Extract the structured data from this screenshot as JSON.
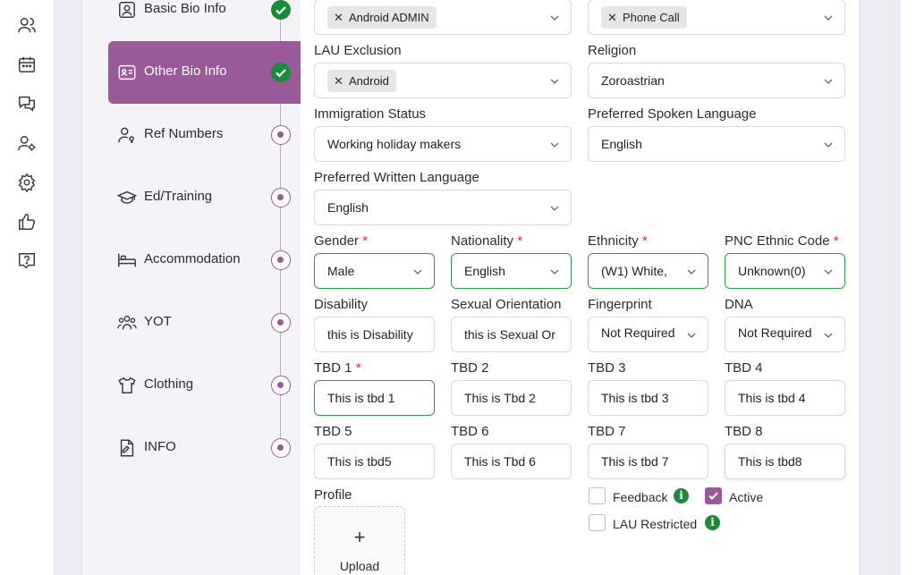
{
  "rail": {
    "icons": [
      "users-icon",
      "calendar-icon",
      "chat-icon",
      "user-settings-icon",
      "gear-icon",
      "thumbs-up-icon",
      "help-chat-icon"
    ]
  },
  "steps": [
    {
      "label": "Basic Bio Info",
      "icon": "user-badge-icon",
      "status": "done"
    },
    {
      "label": "Other Bio Info",
      "icon": "id-card-icon",
      "status": "done",
      "active": true
    },
    {
      "label": "Ref Numbers",
      "icon": "user-key-icon",
      "status": "pending"
    },
    {
      "label": "Ed/Training",
      "icon": "graduation-cap-icon",
      "status": "pending"
    },
    {
      "label": "Accommodation",
      "icon": "bed-icon",
      "status": "pending"
    },
    {
      "label": "YOT",
      "icon": "group-icon",
      "status": "pending"
    },
    {
      "label": "Clothing",
      "icon": "shirt-icon",
      "status": "pending"
    },
    {
      "label": "INFO",
      "icon": "document-icon",
      "status": "pending"
    }
  ],
  "form": {
    "top_left_tag": "Android ADMIN",
    "top_right_tag": "Phone Call",
    "lau_exclusion": {
      "label": "LAU Exclusion",
      "tag": "Android"
    },
    "religion": {
      "label": "Religion",
      "value": "Zoroastrian"
    },
    "immigration_status": {
      "label": "Immigration Status",
      "value": "Working holiday makers"
    },
    "preferred_spoken_language": {
      "label": "Preferred Spoken Language",
      "value": "English"
    },
    "preferred_written_language": {
      "label": "Preferred Written Language",
      "value": "English"
    },
    "gender": {
      "label": "Gender",
      "value": "Male"
    },
    "nationality": {
      "label": "Nationality",
      "value": "English"
    },
    "ethnicity": {
      "label": "Ethnicity",
      "value": "(W1) White,"
    },
    "pnc_ethnic_code": {
      "label": "PNC Ethnic Code",
      "value": "Unknown(0)"
    },
    "required_mark": "*",
    "disability": {
      "label": "Disability",
      "value": "this is Disability"
    },
    "sexual_orientation": {
      "label": "Sexual Orientation",
      "value": "this is Sexual Or"
    },
    "fingerprint": {
      "label": "Fingerprint",
      "value": "Not Required"
    },
    "dna": {
      "label": "DNA",
      "value": "Not Required"
    },
    "tbd1": {
      "label": "TBD 1",
      "value": "This is tbd 1"
    },
    "tbd2": {
      "label": "TBD 2",
      "value": "This is Tbd 2"
    },
    "tbd3": {
      "label": "TBD 3",
      "value": "This is tbd 3"
    },
    "tbd4": {
      "label": "TBD 4",
      "value": "This is tbd 4"
    },
    "tbd5": {
      "label": "TBD 5",
      "value": "This is tbd5"
    },
    "tbd6": {
      "label": "TBD 6",
      "value": "This is Tbd 6"
    },
    "tbd7": {
      "label": "TBD 7",
      "value": "This is tbd 7"
    },
    "tbd8": {
      "label": "TBD 8",
      "value": "This is tbd8"
    },
    "profile": {
      "label": "Profile",
      "upload_plus": "+",
      "upload_label": "Upload"
    },
    "feedback": {
      "label": "Feedback",
      "checked": false
    },
    "active": {
      "label": "Active",
      "checked": true
    },
    "lau_restricted": {
      "label": "LAU Restricted",
      "checked": false
    },
    "info_glyph": "i"
  },
  "colors": {
    "accent": "#9a5a9a",
    "success": "#1d8a3a",
    "required": "#d03030",
    "valid_border": "#2f9a4a"
  }
}
